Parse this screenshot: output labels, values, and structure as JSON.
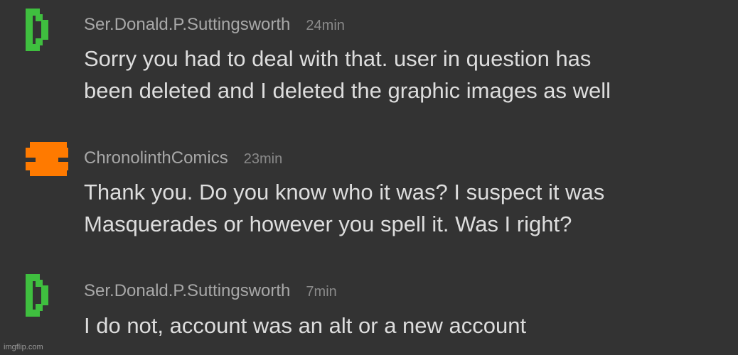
{
  "comments": [
    {
      "username": "Ser.Donald.P.Suttingsworth",
      "time": "24min",
      "lines": [
        "Sorry you had to deal with that. user in question has",
        "been deleted and I deleted the graphic images as well"
      ],
      "avatar_icon": "green-d-pixel-icon",
      "avatar_color": "#3fbf3f"
    },
    {
      "username": "ChronolinthComics",
      "time": "23min",
      "lines": [
        "Thank you. Do you know who it was? I suspect it was",
        "Masquerades or however you spell it. Was I right?"
      ],
      "avatar_icon": "orange-block-pixel-icon",
      "avatar_color": "#ff7a00"
    },
    {
      "username": "Ser.Donald.P.Suttingsworth",
      "time": "7min",
      "lines": [
        "I do not, account was an alt or a new account"
      ],
      "avatar_icon": "green-d-pixel-icon",
      "avatar_color": "#3fbf3f"
    }
  ],
  "watermark": "imgflip.com"
}
